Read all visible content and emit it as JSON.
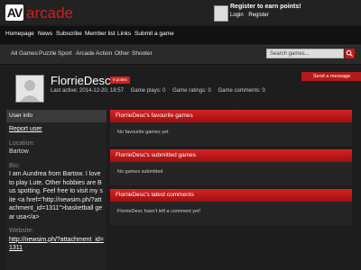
{
  "brand": {
    "logo_mark": "AV",
    "name": "arcade"
  },
  "register": {
    "title": "Register to earn points!",
    "login": "Login",
    "register": "Register"
  },
  "main_nav": [
    "Homepage",
    "News",
    "Subscribe",
    "Member list",
    "Links",
    "Submit a game"
  ],
  "sub_nav": [
    "All Games",
    "Puzzle",
    "Sport",
    "Arcade",
    "Action",
    "Other",
    "Shooter"
  ],
  "search": {
    "placeholder": "Search games..."
  },
  "profile": {
    "username": "FlorrieDesc",
    "points_badge": "0 points",
    "last_active": "Last active: 2014-12-20, 18:57",
    "game_plays": "Game plays: 0",
    "game_ratings": "Game ratings: 0",
    "game_comments": "Game comments: 0",
    "send_message": "Send a message"
  },
  "user_info": {
    "heading": "User info",
    "report": "Report user",
    "location_label": "Location:",
    "location": "Bartow",
    "bio_label": "Bio:",
    "bio": "I am Aundrea from Bartow. I love to play Lute. Other hobbies are Bus spotting. Feel free to visit my site <a href=\"http://newsim.ph/?attachment_id=1311\">basketball gear usa</a>",
    "website_label": "Website:",
    "website": "http://newsim.ph/?attachment_id=1311"
  },
  "panels": {
    "favourites": {
      "heading": "FlorrieDesc's favourite games",
      "body": "No favourite games yet"
    },
    "submitted": {
      "heading": "FlorrieDesc's submitted games",
      "body": "No games submitted"
    },
    "comments": {
      "heading": "FlorrieDesc's latest comments",
      "body": "FlorrieDesc hasn't left a comment yet!"
    }
  },
  "colors": {
    "accent": "#c0181a",
    "background": "#1d1d1d"
  }
}
